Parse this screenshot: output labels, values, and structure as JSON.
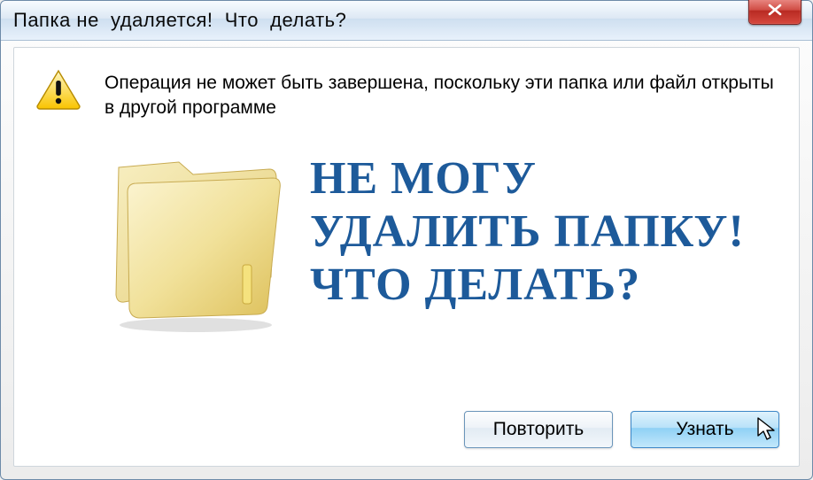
{
  "window": {
    "title": "Папка не  удаляется!  Что  делать?"
  },
  "message": {
    "text": "Операция не может быть завершена, поскольку эти папка или файл открыты в другой программе"
  },
  "overlay": {
    "text": "НЕ МОГУ\nУДАЛИТЬ ПАПКУ!\nЧТО ДЕЛАТЬ?"
  },
  "buttons": {
    "retry": "Повторить",
    "learn": "Узнать"
  },
  "icons": {
    "close": "close-icon",
    "warning": "warning-icon",
    "folder": "folder-icon",
    "cursor": "cursor-icon"
  }
}
